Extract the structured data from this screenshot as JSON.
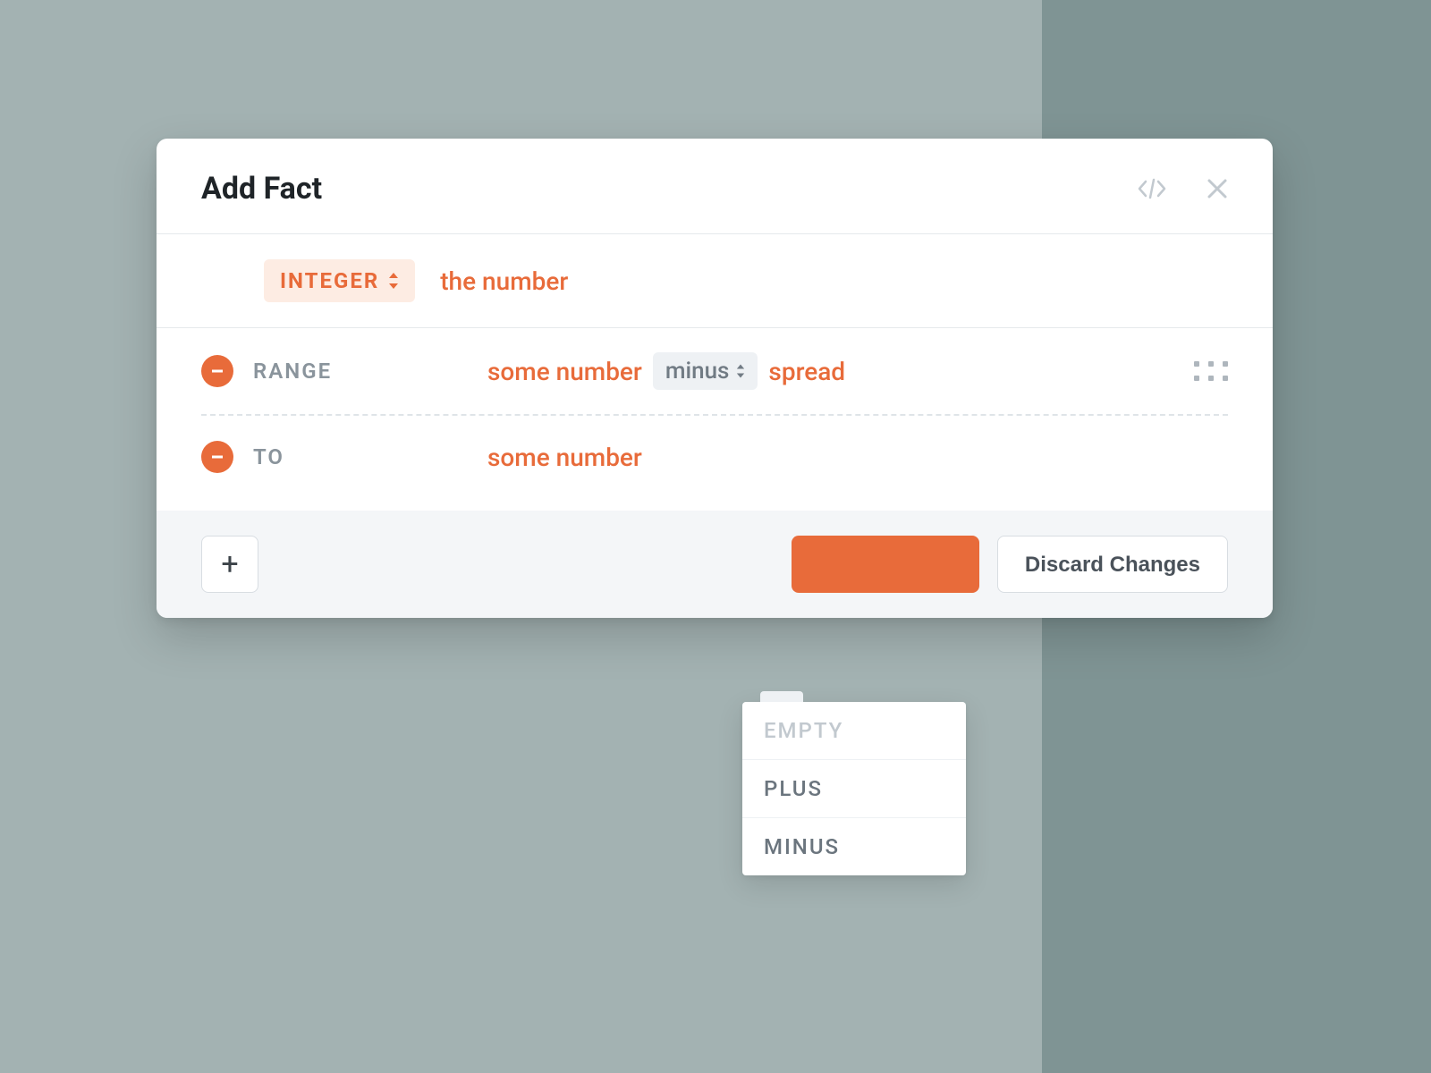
{
  "modal": {
    "title": "Add Fact"
  },
  "type": {
    "label": "INTEGER",
    "name": "the number"
  },
  "rows": [
    {
      "label": "RANGE",
      "lhs": "some number",
      "operator": "minus",
      "rhs": "spread"
    },
    {
      "label": "TO",
      "lhs": "some number"
    }
  ],
  "dropdown": {
    "items": [
      {
        "label": "EMPTY",
        "disabled": true
      },
      {
        "label": "PLUS",
        "disabled": false
      },
      {
        "label": "MINUS",
        "disabled": false
      }
    ]
  },
  "footer": {
    "add": "+",
    "discard": "Discard Changes"
  }
}
